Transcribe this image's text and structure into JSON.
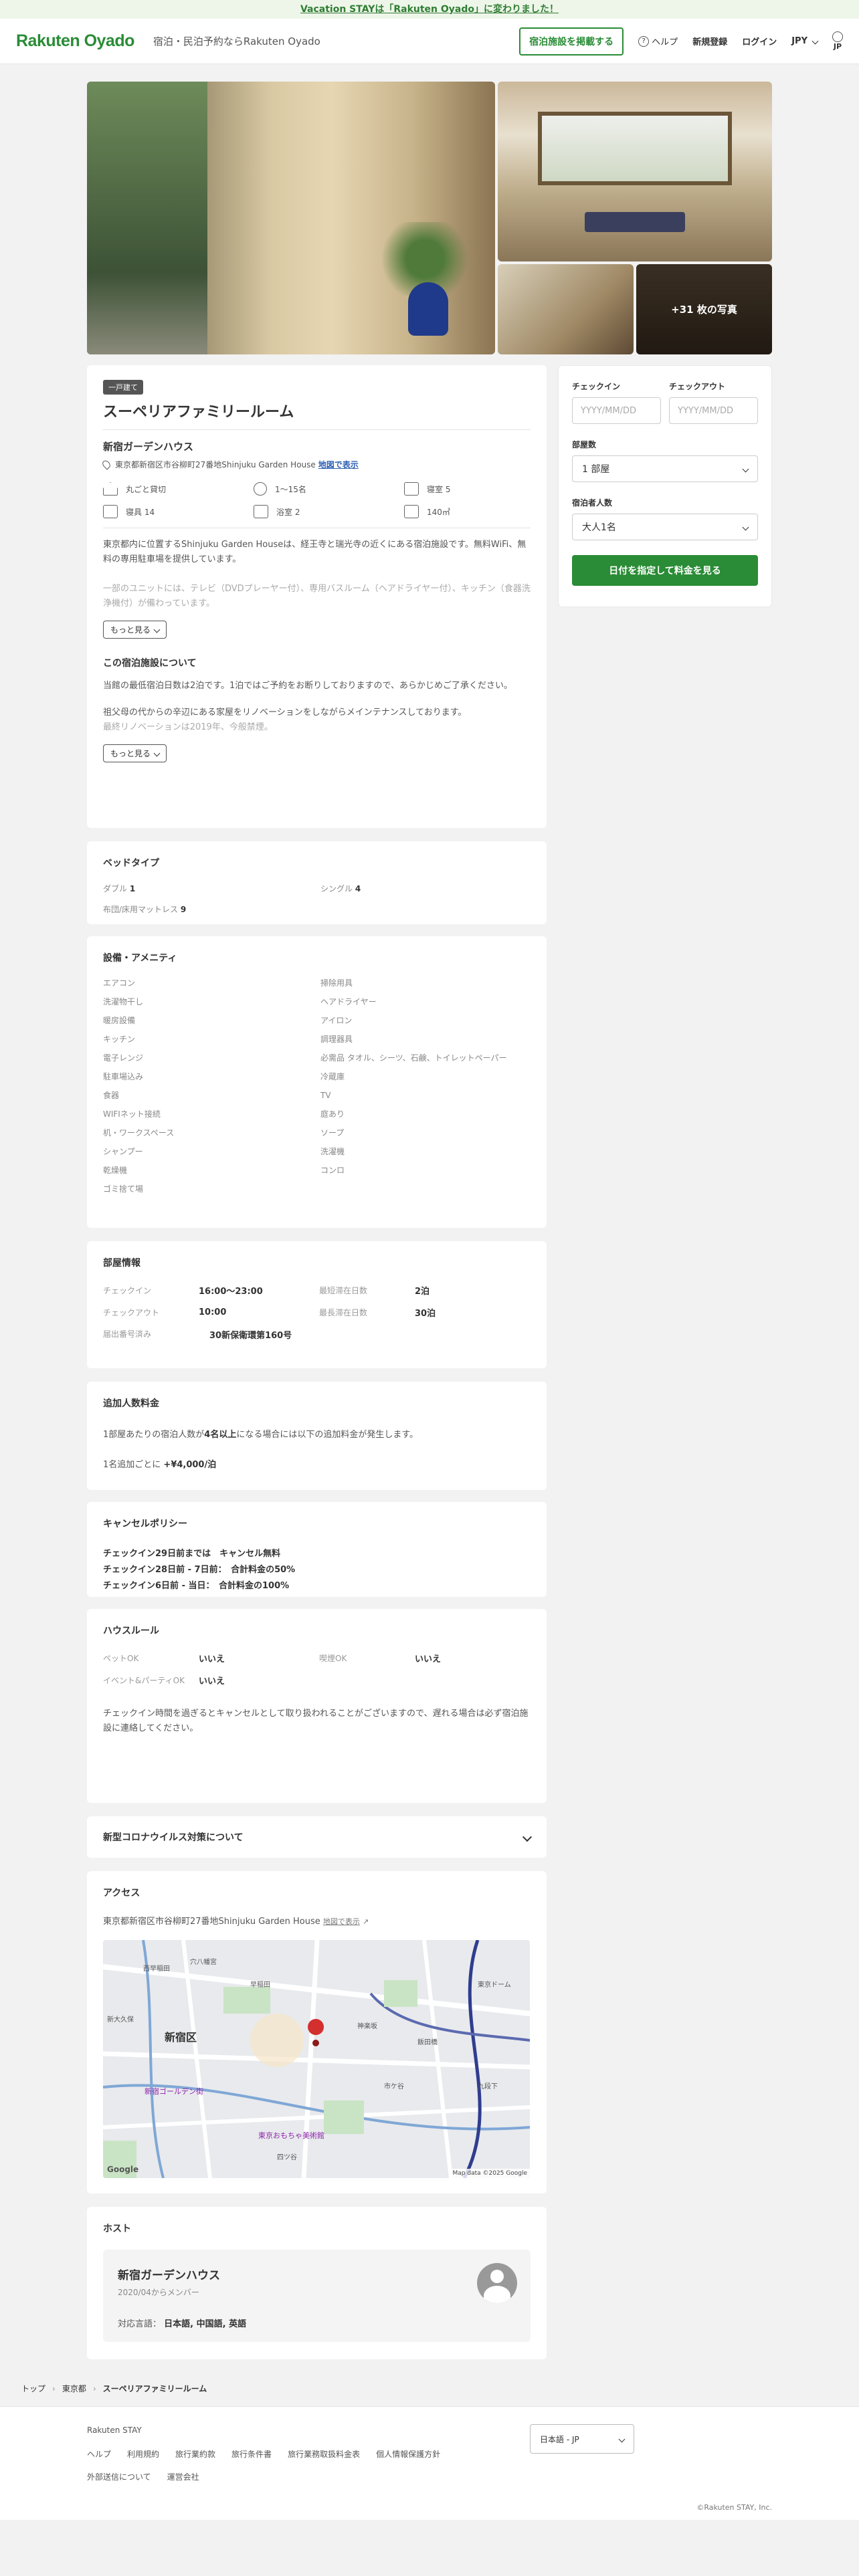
{
  "banner": "Vacation STAYは「Rakuten Oyado」に変わりました！",
  "header": {
    "logo": "Rakuten Oyado",
    "tagline": "宿泊・民泊予約ならRakuten Oyado",
    "list_button": "宿泊施設を掲載する",
    "help": "ヘルプ",
    "signup": "新規登録",
    "login": "ログイン",
    "currency": "JPY",
    "language": "JP"
  },
  "gallery": {
    "more_photos": "+31 枚の写真"
  },
  "listing": {
    "badge": "一戸建て",
    "title": "スーペリアファミリールーム",
    "property_name": "新宿ガーデンハウス",
    "address": "東京都新宿区市谷柳町27番地Shinjuku Garden House",
    "map_link": "地図で表示",
    "specs": [
      "丸ごと貸切",
      "1〜15名",
      "寝室 5",
      "寝具 14",
      "浴室 2",
      "140㎡"
    ],
    "desc1": "東京都内に位置するShinjuku Garden Houseは、経王寺と瑞光寺の近くにある宿泊施設です。無料WiFi、無料の専用駐車場を提供しています。",
    "desc2": "一部のユニットには、テレビ（DVDプレーヤー付）、専用バスルーム（ヘアドライヤー付）、キッチン（食器洗浄機付）が備わっています。",
    "more": "もっと見る",
    "about_title": "この宿泊施設について",
    "about1": "当館の最低宿泊日数は2泊です。1泊ではご予約をお断りしておりますので、あらかじめご了承ください。",
    "about2": "祖父母の代からの辛辺にある家屋をリノベーションをしながらメインテナンスしております。",
    "about3": "最終リノベーションは2019年、今般禁煙。"
  },
  "booking": {
    "checkin_label": "チェックイン",
    "checkout_label": "チェックアウト",
    "checkin_placeholder": "YYYY/MM/DD",
    "checkout_placeholder": "YYYY/MM/DD",
    "rooms_label": "部屋数",
    "rooms_value": "1 部屋",
    "guests_label": "宿泊者人数",
    "guests_value": "大人1名",
    "cta": "日付を指定して料金を見る"
  },
  "beds": {
    "title": "ベッドタイプ",
    "items": [
      {
        "label": "ダブル",
        "count": "1"
      },
      {
        "label": "シングル",
        "count": "4"
      },
      {
        "label": "布団/床用マットレス",
        "count": "9"
      }
    ]
  },
  "amenities": {
    "title": "設備・アメニティ",
    "items": [
      "エアコン",
      "掃除用具",
      "洗濯物干し",
      "ヘアドライヤー",
      "暖房設備",
      "アイロン",
      "キッチン",
      "調理器具",
      "電子レンジ",
      "必需品 タオル、シーツ、石鹸、トイレットペーパー",
      "駐車場込み",
      "冷蔵庫",
      "食器",
      "TV",
      "WIFIネット接続",
      "庭あり",
      "机・ワークスペース",
      "ソープ",
      "シャンプー",
      "洗濯機",
      "乾燥機",
      "コンロ",
      "ゴミ捨て場"
    ]
  },
  "room_info": {
    "title": "部屋情報",
    "checkin_k": "チェックイン",
    "checkin_v": "16:00〜23:00",
    "min_k": "最短滞在日数",
    "min_v": "2泊",
    "checkout_k": "チェックアウト",
    "checkout_v": "10:00",
    "max_k": "最長滞在日数",
    "max_v": "30泊",
    "license_k": "届出番号済み",
    "license_v": "30新保衛環第160号"
  },
  "extra": {
    "title": "追加人数料金",
    "line1_a": "1部屋あたりの宿泊人数が",
    "line1_b": "4名以上",
    "line1_c": "になる場合には以下の追加料金が発生します。",
    "line2_a": "1名追加ごとに",
    "line2_b": "+¥4,000/泊"
  },
  "cancel": {
    "title": "キャンセルポリシー",
    "lines": [
      "チェックイン29日前までは　キャンセル無料",
      "チェックイン28日前 - 7日前：　合計料金の50%",
      "チェックイン6日前 - 当日：　合計料金の100%"
    ]
  },
  "rules": {
    "title": "ハウスルール",
    "pet_k": "ペットOK",
    "pet_v": "いいえ",
    "smoke_k": "喫煙OK",
    "smoke_v": "いいえ",
    "event_k": "イベント&パーティOK",
    "event_v": "いいえ",
    "note": "チェックイン時間を過ぎるとキャンセルとして取り扱われることがございますので、遅れる場合は必ず宿泊施設に連絡してください。"
  },
  "covid": {
    "title": "新型コロナウイルス対策について"
  },
  "access": {
    "title": "アクセス",
    "address": "東京都新宿区市谷柳町27番地Shinjuku Garden House",
    "map_link": "地図で表示",
    "map_labels": [
      "新宿区",
      "東京おもちゃ美術館",
      "新宿ゴールデン街",
      "西早稲田",
      "早稲田",
      "神楽坂",
      "飯田橋",
      "四ツ谷",
      "市ケ谷",
      "新大久保",
      "穴八幡宮",
      "東京ドーム",
      "九段下"
    ],
    "google": "Google",
    "attribution": "Map data ©2025 Google"
  },
  "host": {
    "title": "ホスト",
    "name": "新宿ガーデンハウス",
    "since": "2020/04からメンバー",
    "lang_k": "対応言語：",
    "lang_v": "日本語, 中国語, 英語"
  },
  "breadcrumb": [
    "トップ",
    "東京都",
    "スーペリアファミリールーム"
  ],
  "footer": {
    "brand": "Rakuten STAY",
    "links": [
      "ヘルプ",
      "利用規約",
      "旅行業約款",
      "旅行条件書",
      "旅行業務取扱料金表",
      "個人情報保護方針"
    ],
    "links2": [
      "外部送信について",
      "運営会社"
    ],
    "language": "日本語 - JP",
    "copyright": "©Rakuten STAY, Inc."
  },
  "colors": {
    "brand": "#2a8c36",
    "link": "#2d5fb4",
    "map_pin": "#d32f2f"
  }
}
